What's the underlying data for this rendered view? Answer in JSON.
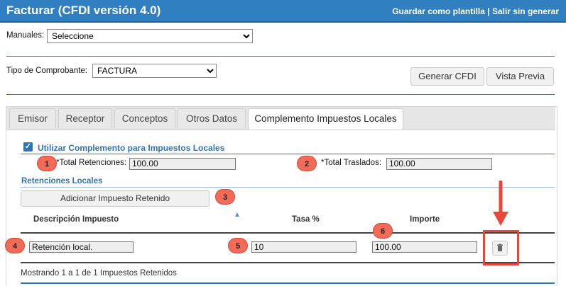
{
  "header": {
    "title": "Facturar (CFDI versión 4.0)",
    "save_template": "Guardar como plantilla",
    "separator": " | ",
    "exit": "Salir sin generar"
  },
  "manuales": {
    "label": "Manuales:",
    "selected": "Seleccione"
  },
  "tipo": {
    "label": "Tipo de Comprobante:",
    "selected": "FACTURA"
  },
  "actions": {
    "generar": "Generar CFDI",
    "vista": "Vista Previa"
  },
  "tabs": [
    {
      "label": "Emisor",
      "active": false
    },
    {
      "label": "Receptor",
      "active": false
    },
    {
      "label": "Conceptos",
      "active": false
    },
    {
      "label": "Otros Datos",
      "active": false
    },
    {
      "label": "Complemento Impuestos Locales",
      "active": true
    }
  ],
  "complemento": {
    "checkbox_label": "Utilizar Complemento para Impuestos Locales",
    "checked": true,
    "total_retenciones_label": "*Total Retenciones:",
    "total_retenciones_value": "100.00",
    "total_traslados_label": "*Total Traslados:",
    "total_traslados_value": "100.00",
    "section_title": "Retenciones Locales",
    "add_button": "Adicionar Impuesto Retenido"
  },
  "table": {
    "columns": [
      "Descripción Impuesto",
      "Tasa %",
      "Importe"
    ],
    "sort_arrow": "▲",
    "rows": [
      {
        "descripcion": "Retención local.",
        "tasa": "10",
        "importe": "100.00"
      }
    ],
    "footer": "Mostrando 1 a 1 de 1 Impuestos Retenidos"
  },
  "annotations": [
    "1",
    "2",
    "3",
    "4",
    "5",
    "6"
  ],
  "colors": {
    "header": "#2f7fc1",
    "badge": "#f26a58",
    "highlight": "#e8473a"
  }
}
